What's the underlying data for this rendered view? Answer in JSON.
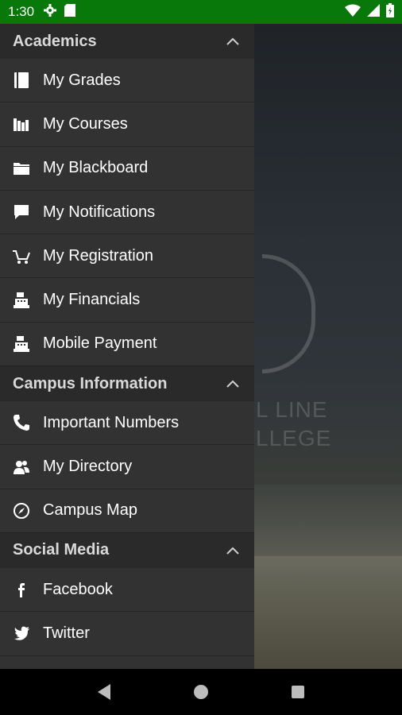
{
  "status": {
    "time": "1:30"
  },
  "drawer": {
    "sections": [
      {
        "title": "Academics",
        "items": [
          {
            "label": "My Grades",
            "icon": "book-icon"
          },
          {
            "label": "My Courses",
            "icon": "library-icon"
          },
          {
            "label": "My Blackboard",
            "icon": "folder-icon"
          },
          {
            "label": "My Notifications",
            "icon": "chat-bubble-icon"
          },
          {
            "label": "My Registration",
            "icon": "cart-icon"
          },
          {
            "label": "My Financials",
            "icon": "cash-register-icon"
          },
          {
            "label": "Mobile Payment",
            "icon": "cash-register-icon"
          }
        ]
      },
      {
        "title": "Campus Information",
        "items": [
          {
            "label": "Important Numbers",
            "icon": "phone-icon"
          },
          {
            "label": "My Directory",
            "icon": "people-icon"
          },
          {
            "label": "Campus Map",
            "icon": "compass-icon"
          }
        ]
      },
      {
        "title": "Social Media",
        "items": [
          {
            "label": "Facebook",
            "icon": "facebook-icon"
          },
          {
            "label": "Twitter",
            "icon": "twitter-icon"
          }
        ]
      }
    ]
  },
  "background": {
    "logo_text_line1": "L LINE",
    "logo_text_line2": "LLEGE"
  }
}
